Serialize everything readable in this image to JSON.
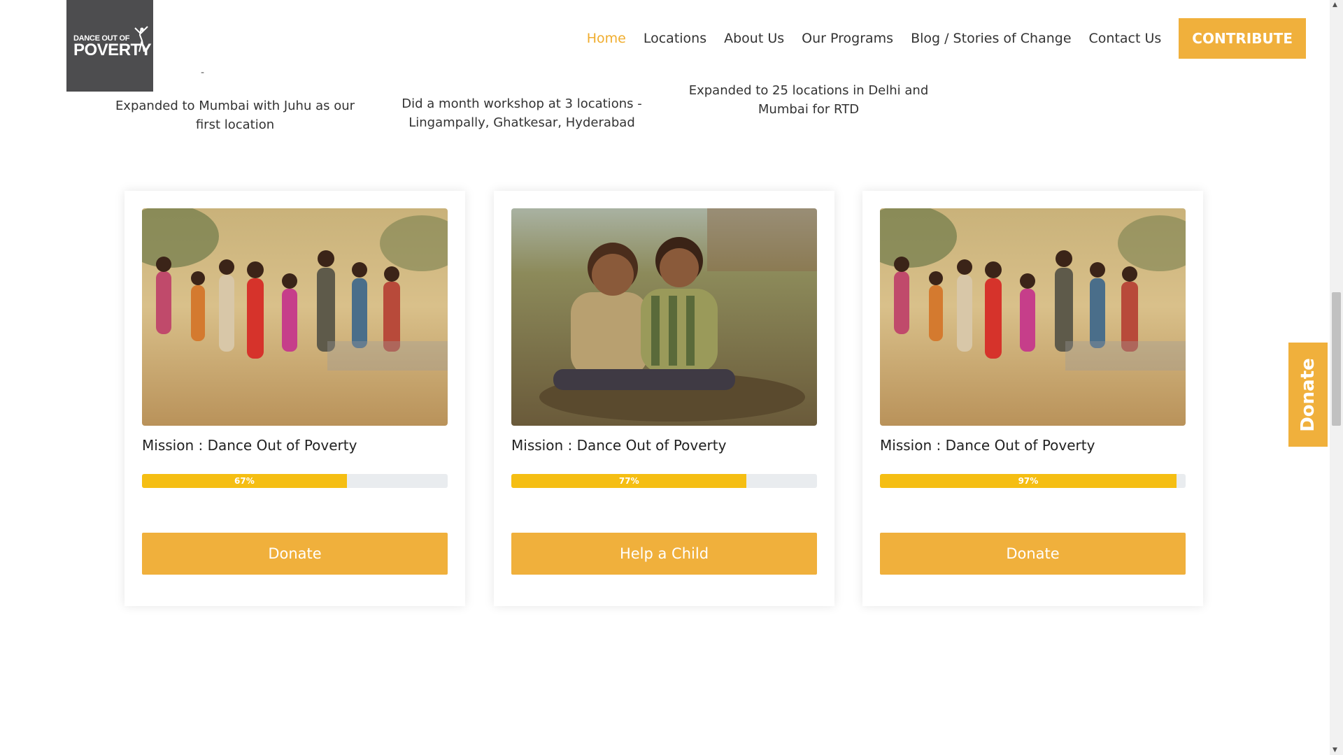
{
  "logo": {
    "line1": "DANCE OUT OF",
    "line2": "POVERTY"
  },
  "nav": {
    "items": [
      "Home",
      "Locations",
      "About Us",
      "Our Programs",
      "Blog / Stories of Change",
      "Contact Us"
    ],
    "active": "Home",
    "cta": "CONTRIBUTE"
  },
  "timeline": [
    {
      "dash": "-",
      "text": "Expanded to Mumbai with Juhu as our first location"
    },
    {
      "text": "Did a month workshop at 3 locations - Lingampally, Ghatkesar, Hyderabad"
    },
    {
      "text": "Expanded to 25 locations in Delhi and Mumbai for RTD"
    }
  ],
  "cards": [
    {
      "image": "children-running-photo",
      "title": "Mission : Dance Out of Poverty",
      "progress": 67,
      "progress_label": "67%",
      "button": "Donate"
    },
    {
      "image": "two-boys-sitting-photo",
      "title": "Mission : Dance Out of Poverty",
      "progress": 77,
      "progress_label": "77%",
      "button": "Help a Child"
    },
    {
      "image": "children-running-photo",
      "title": "Mission : Dance Out of Poverty",
      "progress": 97,
      "progress_label": "97%",
      "button": "Donate"
    }
  ],
  "side_donate": "Donate",
  "colors": {
    "accent": "#f0b03c",
    "progress": "#f5be13",
    "active_nav": "#f0ad2e",
    "logo_bg": "#4d4d4f"
  }
}
